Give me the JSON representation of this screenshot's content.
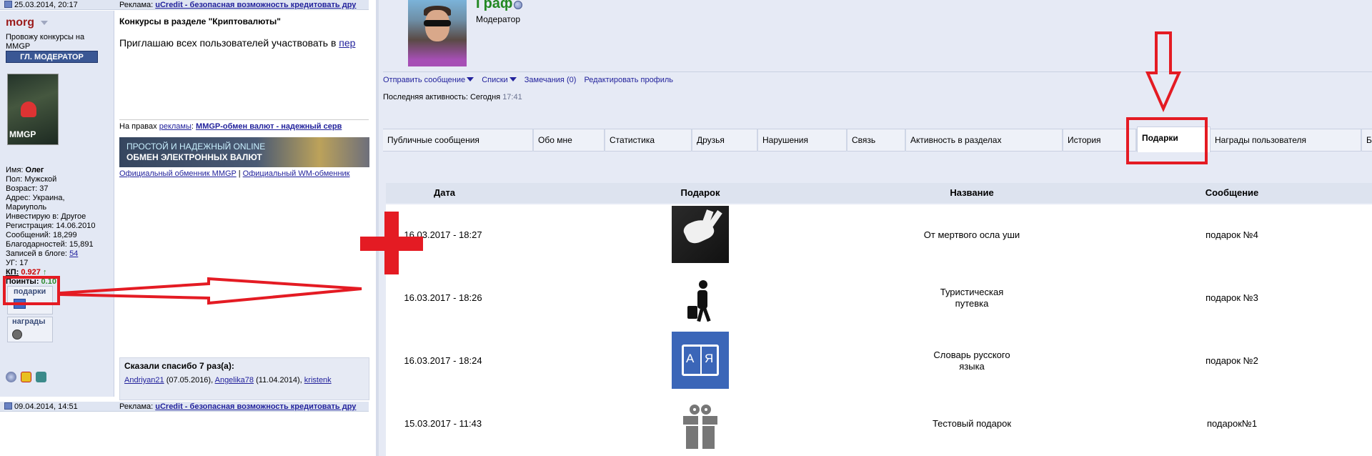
{
  "left": {
    "post1": {
      "date": "25.03.2014, 20:17",
      "ad_prefix": "Реклама:",
      "ad_link": "uCredit - безопасная возможность кредитовать дру"
    },
    "post2": {
      "date": "09.04.2014, 14:51",
      "ad_prefix": "Реклама:",
      "ad_link": "uCredit - безопасная возможность кредитовать дру"
    },
    "user": {
      "name": "morg",
      "status": "Провожу конкурсы на MMGP",
      "rank": "ГЛ. МОДЕРАТОР",
      "avatar_logo": "MMGP",
      "info": [
        {
          "label": "Имя:",
          "value": "Олег"
        },
        {
          "label": "Пол:",
          "value": "Мужской"
        },
        {
          "label": "Возраст:",
          "value": "37"
        },
        {
          "label": "Адрес:",
          "value": "Украина,"
        },
        {
          "label": "",
          "value": "Мариуполь"
        },
        {
          "label": "Инвестирую в:",
          "value": "Другое"
        },
        {
          "label": "Регистрация:",
          "value": "14.06.2010"
        },
        {
          "label": "Сообщений:",
          "value": "18,299"
        },
        {
          "label": "Благодарностей:",
          "value": "15,891"
        },
        {
          "label": "Записей в блоге:",
          "value": "54"
        },
        {
          "label": "УГ:",
          "value": "17"
        }
      ],
      "kp_label": "КП:",
      "kp_value": "0.927",
      "kp_arrow": "↑",
      "points_label": "Поинты:",
      "points_value": "0.10",
      "gifts_label": "подарки",
      "awards_label": "награды"
    },
    "post": {
      "title": "Конкурсы в разделе \"Криптовалюты\"",
      "text_prefix": "Приглашаю всех пользователей участвовать в ",
      "text_link": "пер",
      "sig_prefix": "На правах ",
      "sig_link1": "рекламы",
      "sig_colon": ":",
      "sig_link2": "MMGP-обмен валют - надежный серв",
      "banner_line1": "ПРОСТОЙ И НАДЕЖНЫЙ ONLINE",
      "banner_line2": "ОБМЕН ЭЛЕКТРОННЫХ ВАЛЮТ",
      "link_a": "Официальный обменник MMGP",
      "link_sep": " | ",
      "link_b": "Официальный WM-обменник",
      "thanks_title": "Сказали спасибо 7 раз(а):",
      "thanks_names": [
        {
          "name": "Andriyan21",
          "date": " (07.05.2016), "
        },
        {
          "name": "Angelika78",
          "date": " (11.04.2014), "
        },
        {
          "name": "kristenk",
          "date": ""
        }
      ]
    }
  },
  "right": {
    "profile": {
      "name": "Граф",
      "role": "Модератор",
      "actions": [
        "Отправить сообщение",
        "Списки",
        "Замечания (0)",
        "Редактировать профиль"
      ],
      "activity_label": "Последняя активность:",
      "activity_day": "Сегодня",
      "activity_time": "17:41"
    },
    "tabs": [
      "Публичные сообщения",
      "Обо мне",
      "Статистика",
      "Друзья",
      "Нарушения",
      "Связь",
      "Активность в разделах",
      "История",
      "Подарки",
      "Награды пользователя",
      "Б"
    ],
    "active_tab": "Подарки",
    "table": {
      "headers": [
        "Дата",
        "Подарок",
        "Название",
        "Сообщение"
      ],
      "rows": [
        {
          "date": "16.03.2017 - 18:27",
          "gift_icon": "dead-donkey-ears-icon",
          "name_line1": "От мертвого осла уши",
          "name_line2": "",
          "message": "подарок №4"
        },
        {
          "date": "16.03.2017 - 18:26",
          "gift_icon": "traveler-icon",
          "name_line1": "Туристическая",
          "name_line2": "путевка",
          "message": "подарок №3"
        },
        {
          "date": "16.03.2017 - 18:24",
          "gift_icon": "dictionary-icon",
          "name_line1": "Словарь русского",
          "name_line2": "языка",
          "message": "подарок №2"
        },
        {
          "date": "15.03.2017 - 11:43",
          "gift_icon": "gift-box-icon",
          "name_line1": "Тестовый подарок",
          "name_line2": "",
          "message": "подарок№1"
        }
      ]
    }
  },
  "dict_letters": {
    "left": "А",
    "right": "Я"
  },
  "colors": {
    "annotation": "#e41b23",
    "link": "#22229c",
    "username": "#9b1b1b",
    "profile_name": "#228822"
  }
}
